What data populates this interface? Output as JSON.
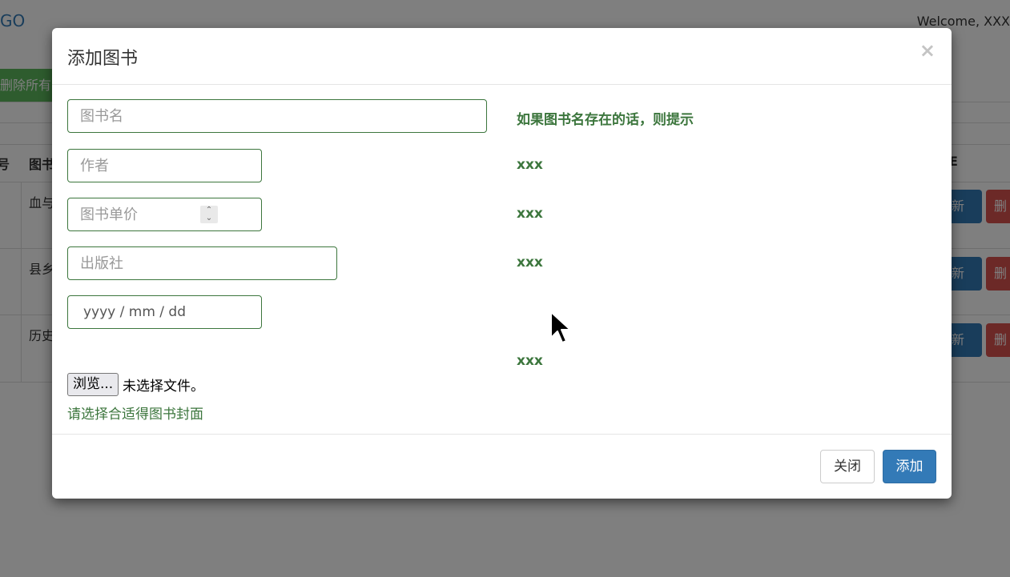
{
  "background": {
    "brand": "GO",
    "welcome": "Welcome, XXX",
    "delete_all_button": "删除所有",
    "table": {
      "headers": [
        "号",
        "图书",
        "E"
      ],
      "rows": [
        {
          "name": "血与",
          "update": "更新",
          "delete": "删"
        },
        {
          "name": "县乡",
          "update": "更新",
          "delete": "删"
        },
        {
          "name": "历史",
          "update": "更新",
          "delete": "删"
        }
      ]
    }
  },
  "modal": {
    "title": "添加图书",
    "close_symbol": "×",
    "fields": {
      "book_name": {
        "placeholder": "图书名",
        "value": "",
        "hint": "如果图书名存在的话，则提示"
      },
      "author": {
        "placeholder": "作者",
        "value": "",
        "hint": "xxx"
      },
      "price": {
        "placeholder": "图书单价",
        "value": "",
        "hint": "xxx"
      },
      "publisher": {
        "placeholder": "出版社",
        "value": "",
        "hint": "xxx"
      },
      "date": {
        "placeholder": "yyyy / mm / dd"
      },
      "cover": {
        "browse_label": "浏览...",
        "status": "未选择文件。",
        "help": "请选择合适得图书封面",
        "hint": "xxx"
      }
    },
    "footer": {
      "close_label": "关闭",
      "add_label": "添加"
    }
  },
  "colors": {
    "primary": "#337ab7",
    "success_text": "#3c763d",
    "danger": "#d9534f",
    "success_button": "#5cb85c"
  }
}
